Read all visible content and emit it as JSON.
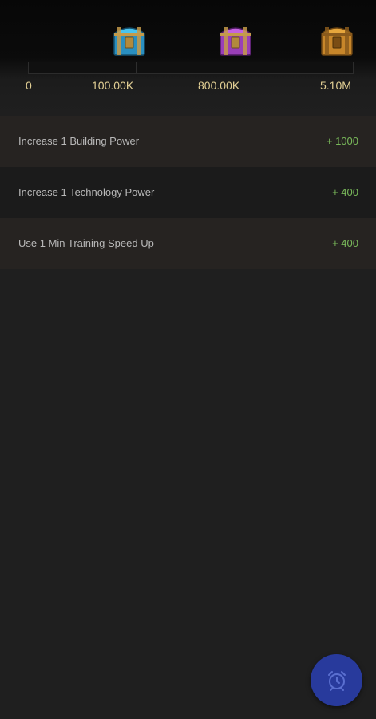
{
  "rewards": {
    "chests": [
      {
        "icon": "blue-chest-icon",
        "color": "#3fb6dd"
      },
      {
        "icon": "purple-chest-icon",
        "color": "#b04fcc"
      },
      {
        "icon": "gold-chest-icon",
        "color": "#d9962a"
      }
    ],
    "progress_fraction": 0,
    "milestones": [
      "0",
      "100.00K",
      "800.00K",
      "5.10M"
    ]
  },
  "tasks": [
    {
      "label": "Increase 1 Building Power",
      "points": "+ 1000"
    },
    {
      "label": "Increase 1 Technology Power",
      "points": "+ 400"
    },
    {
      "label": "Use 1 Min Training Speed Up",
      "points": "+ 400"
    }
  ],
  "fab": {
    "icon": "alarm-clock-icon",
    "color": "#283a9c"
  },
  "colors": {
    "background": "#1f1f1f",
    "milestone_text": "#e2cf94",
    "task_text": "#b8b8b8",
    "points_text": "#79b95a"
  }
}
